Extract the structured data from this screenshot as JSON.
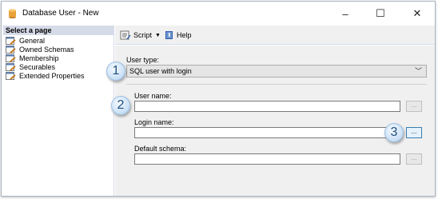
{
  "window": {
    "title": "Database User - New",
    "minimize": "–",
    "maximize": "☐",
    "close": "✕"
  },
  "left_pane": {
    "header": "Select a page",
    "items": [
      {
        "label": "General",
        "icon": "wrench-page-icon"
      },
      {
        "label": "Owned Schemas",
        "icon": "wrench-page-icon"
      },
      {
        "label": "Membership",
        "icon": "wrench-page-icon"
      },
      {
        "label": "Securables",
        "icon": "wrench-page-icon"
      },
      {
        "label": "Extended Properties",
        "icon": "wrench-page-icon"
      }
    ]
  },
  "toolbar": {
    "script_label": "Script",
    "script_arrow": "▼",
    "help_label": "Help"
  },
  "form": {
    "user_type_label": "User type:",
    "user_type_value": "SQL user with login",
    "user_name_label": "User name:",
    "user_name_value": "",
    "login_name_label": "Login name:",
    "login_name_value": "",
    "default_schema_label": "Default schema:",
    "default_schema_value": "",
    "browse_label": "..."
  },
  "callouts": {
    "one": "1",
    "two": "2",
    "three": "3"
  },
  "colors": {
    "pane_header_bg": "#d6dbe9",
    "content_bg": "#f0f0f0",
    "callout_fill": "#cfe3f7",
    "active_button_border": "#3c7fb1"
  }
}
